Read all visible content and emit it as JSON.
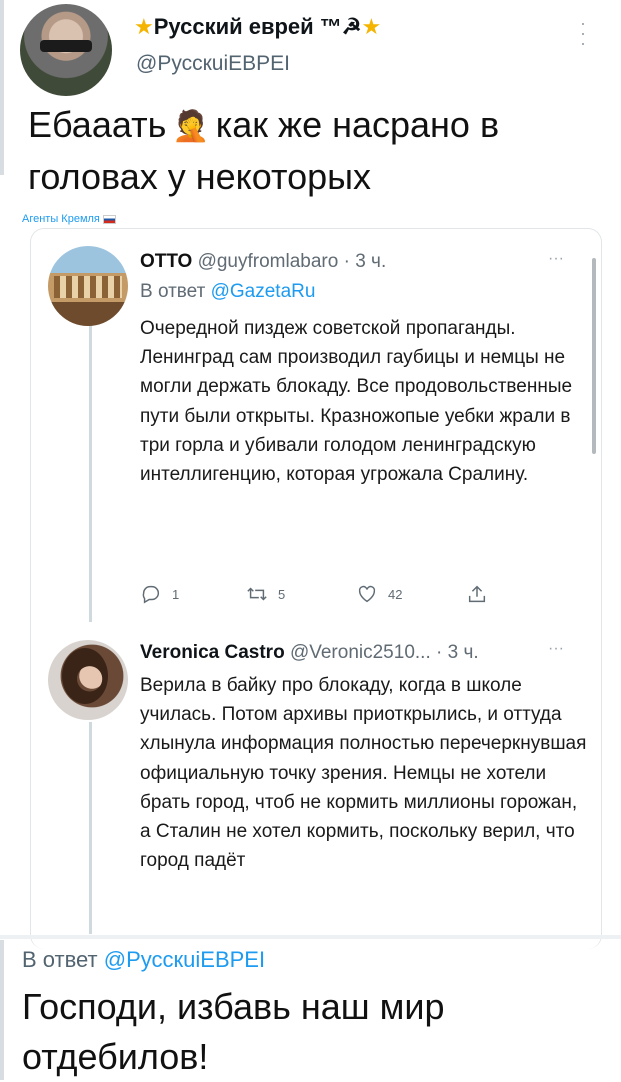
{
  "top_tweet": {
    "name_prefix": "★",
    "name": "Русский еврей ™☭",
    "name_suffix": "★",
    "handle": "@РусскuiЕВРЕI",
    "text_before": "Ебааать",
    "emoji": "🤦",
    "text_after": "как же насрано в головах у некоторых",
    "caption": "Агенты Кремля"
  },
  "quoted": {
    "otto": {
      "name": "ОТТО",
      "handle": "@guyfromlabaro",
      "time": "· 3 ч.",
      "reply_prefix": "В ответ",
      "reply_handle": "@GazetaRu",
      "body": "Очередной пиздеж советской пропаганды. Ленинград сам производил гаубицы и немцы не могли держать блокаду. Все продовольственные пути были открыты. Кразножопые уебки жрали в три горла и убивали голодом ленинградскую интеллигенцию, которая угрожала Сралину.",
      "replies": "1",
      "retweets": "5",
      "likes": "42"
    },
    "veronica": {
      "name": "Veronica Castro",
      "handle": "@Veronic2510...",
      "time": "· 3 ч.",
      "body": "Верила в байку про блокаду, когда в школе училась. Потом архивы приоткрылись, и оттуда хлынула информация полностью перечеркнувшая официальную точку зрения. Немцы не хотели брать город, чтоб не кормить миллионы горожан, а Сталин не хотел кормить, поскольку верил, что город падёт"
    }
  },
  "bottom_tweet": {
    "reply_prefix": "В ответ",
    "reply_handle": "@РусскuiЕВРЕI",
    "text": "Господи, избавь наш мир отдебилов!"
  },
  "icons": [
    "more-icon",
    "reply-icon",
    "retweet-icon",
    "like-icon",
    "share-icon"
  ],
  "colors": {
    "link": "#1d9bf0",
    "secondary": "#606b74",
    "star": "#f4b400"
  }
}
